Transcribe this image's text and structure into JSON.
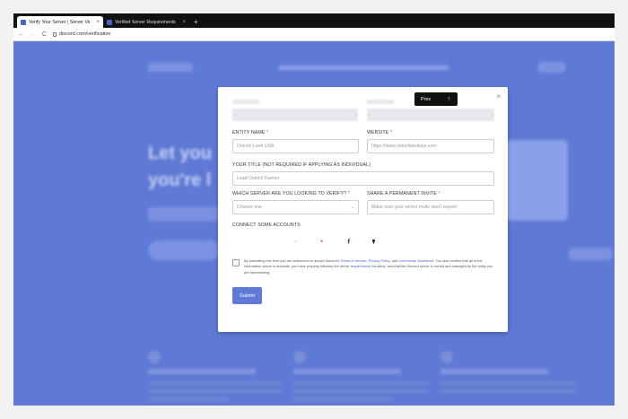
{
  "browser": {
    "tabs": [
      {
        "label": "Verify Your Server | Server Ve"
      },
      {
        "label": "Verified Server Requirements"
      }
    ],
    "new_tab": "+",
    "url": "discord.com/verification",
    "back": "←",
    "forward": "→",
    "reload": "C"
  },
  "background": {
    "headline_line1": "Let you",
    "headline_line2": "you're l"
  },
  "popover": {
    "label": "Prev",
    "arrow": "↑"
  },
  "modal": {
    "close": "×",
    "entity_name": {
      "label": "ENTITY NAME",
      "required": "*",
      "value": "Ostrich Land USA"
    },
    "website": {
      "label": "WEBSITE",
      "required": "*",
      "placeholder": "https://www.ostrichlandusa.com"
    },
    "title": {
      "label": "YOUR TITLE (NOT REQUIRED IF APPLYING AS INDIVIDUAL)",
      "placeholder": "Lead Ostrich Farmer"
    },
    "server": {
      "label": "WHICH SERVER ARE YOU LOOKING TO VERIFY?",
      "required": "*",
      "selected": "Choose one"
    },
    "invite": {
      "label": "SHARE A PERMANENT INVITE",
      "required": "*",
      "placeholder": "Make sure your server invite won't expire!"
    },
    "accounts_label": "CONNECT SOME ACCOUNTS",
    "socials": [
      {
        "name": "twitch",
        "color": "#6441a5"
      },
      {
        "name": "twitter",
        "color": "#1da1f2"
      },
      {
        "name": "reddit",
        "color": "#ff4500"
      },
      {
        "name": "youtube",
        "color": "#e62117"
      },
      {
        "name": "facebook",
        "color": "#3b5998"
      },
      {
        "name": "github",
        "color": "#1b1f23"
      }
    ],
    "terms": {
      "t1": "By submitting this form you are authorized to accept Discord's ",
      "tos": "Terms of Service",
      "t2": ", ",
      "privacy": "Privacy Policy",
      "t3": ", and ",
      "guidelines": "Community Guidelines",
      "t4": ". You also confirm that all of the information above is accurate, you have properly followed the server ",
      "requirements": "requirements",
      "t5": " for setup, and that the Discord server is owned and managed by the entity you are representing."
    },
    "submit": "Submit"
  }
}
